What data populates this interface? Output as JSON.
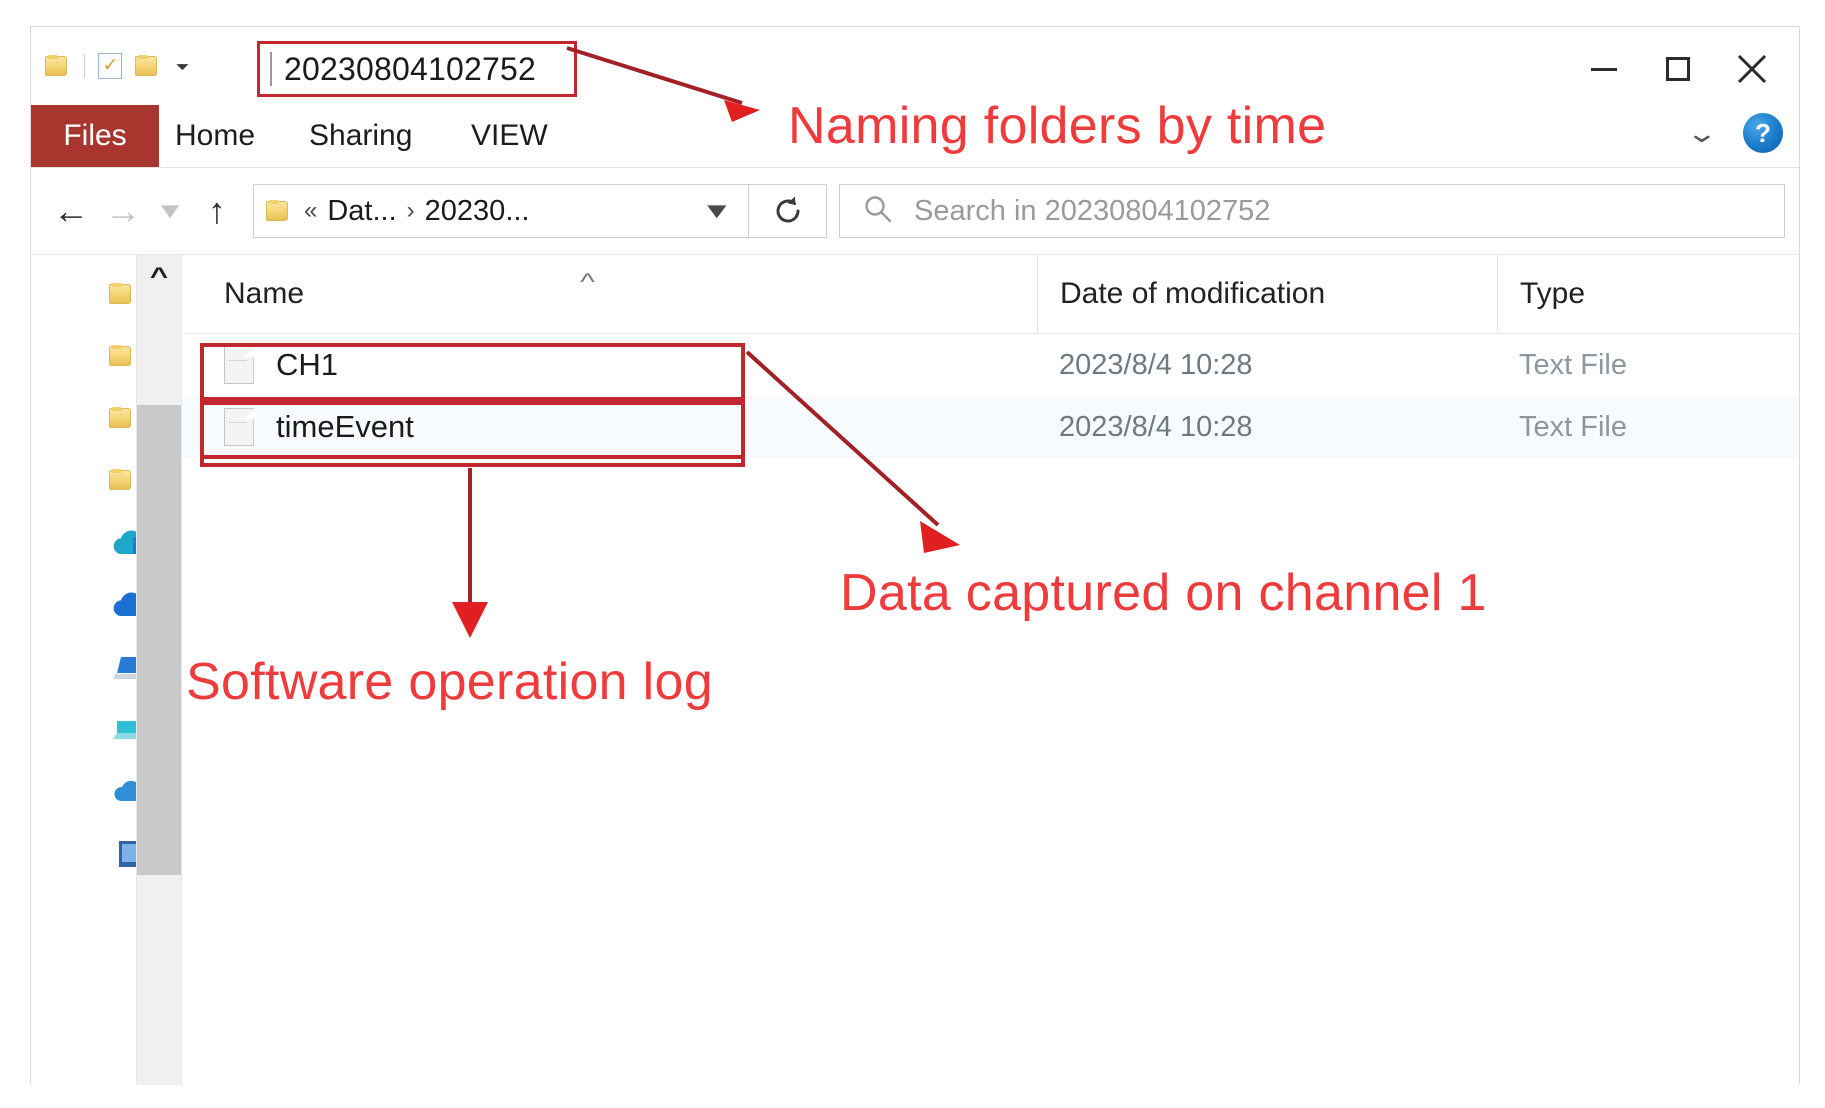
{
  "window": {
    "quick_access": {
      "folder_icon": "folder-icon",
      "properties_icon": "checked-document-icon",
      "new_folder_icon": "folder-icon",
      "customize_caret": "chevron-down-icon"
    },
    "path_value": "20230804102752",
    "controls": {
      "minimize": "minimize-icon",
      "maximize": "maximize-icon",
      "close": "close-icon"
    }
  },
  "ribbon": {
    "tabs": [
      {
        "label": "Files",
        "active": true
      },
      {
        "label": "Home",
        "active": false
      },
      {
        "label": "Sharing",
        "active": false
      },
      {
        "label": "VIEW",
        "active": false
      }
    ],
    "collapse_icon": "chevron-down-icon",
    "help_icon": "question-mark-icon",
    "help_label": "?"
  },
  "nav": {
    "back_icon": "arrow-left-icon",
    "forward_icon": "arrow-right-icon",
    "recent_icon": "chevron-down-icon",
    "up_icon": "arrow-up-icon",
    "address": {
      "folder_icon": "folder-icon",
      "overflow": "«",
      "crumbs": [
        "Dat...",
        "20230..."
      ],
      "separator": "›",
      "dropdown_icon": "chevron-down-icon"
    },
    "refresh_icon": "refresh-icon",
    "search": {
      "icon": "search-icon",
      "placeholder": "Search in 20230804102752",
      "value": ""
    }
  },
  "sidebar": {
    "items": [
      {
        "icon": "folder-icon",
        "label": ""
      },
      {
        "icon": "folder-icon",
        "label": ""
      },
      {
        "icon": "folder-icon",
        "label": ""
      },
      {
        "icon": "folder-icon",
        "label": ""
      },
      {
        "icon": "cloud-teal-icon",
        "label": ""
      },
      {
        "icon": "cloud-blue-icon",
        "label": ""
      },
      {
        "icon": "laptop-icon",
        "label": ""
      },
      {
        "icon": "drive-icon",
        "label": ""
      },
      {
        "icon": "cloud-small-icon",
        "label": ""
      },
      {
        "icon": "device-icon",
        "label": ""
      }
    ],
    "scroll_up_icon": "chevron-up-icon"
  },
  "filelist": {
    "columns": [
      "Name",
      "Date of modification",
      "Type"
    ],
    "sort_indicator": "chevron-up-icon",
    "rows": [
      {
        "icon": "text-file-icon",
        "name": "CH1",
        "date": "2023/8/4 10:28",
        "type": "Text File"
      },
      {
        "icon": "text-file-icon",
        "name": "timeEvent",
        "date": "2023/8/4 10:28",
        "type": "Text File"
      }
    ]
  },
  "annotations": {
    "color": "#ef3b3b",
    "box_color": "#c1272d",
    "callouts": [
      {
        "text": "Naming folders by time",
        "target": "path-field"
      },
      {
        "text": "Data captured on channel 1",
        "target": "ch1-row"
      },
      {
        "text": "Software operation log",
        "target": "timeevent-row"
      }
    ]
  }
}
